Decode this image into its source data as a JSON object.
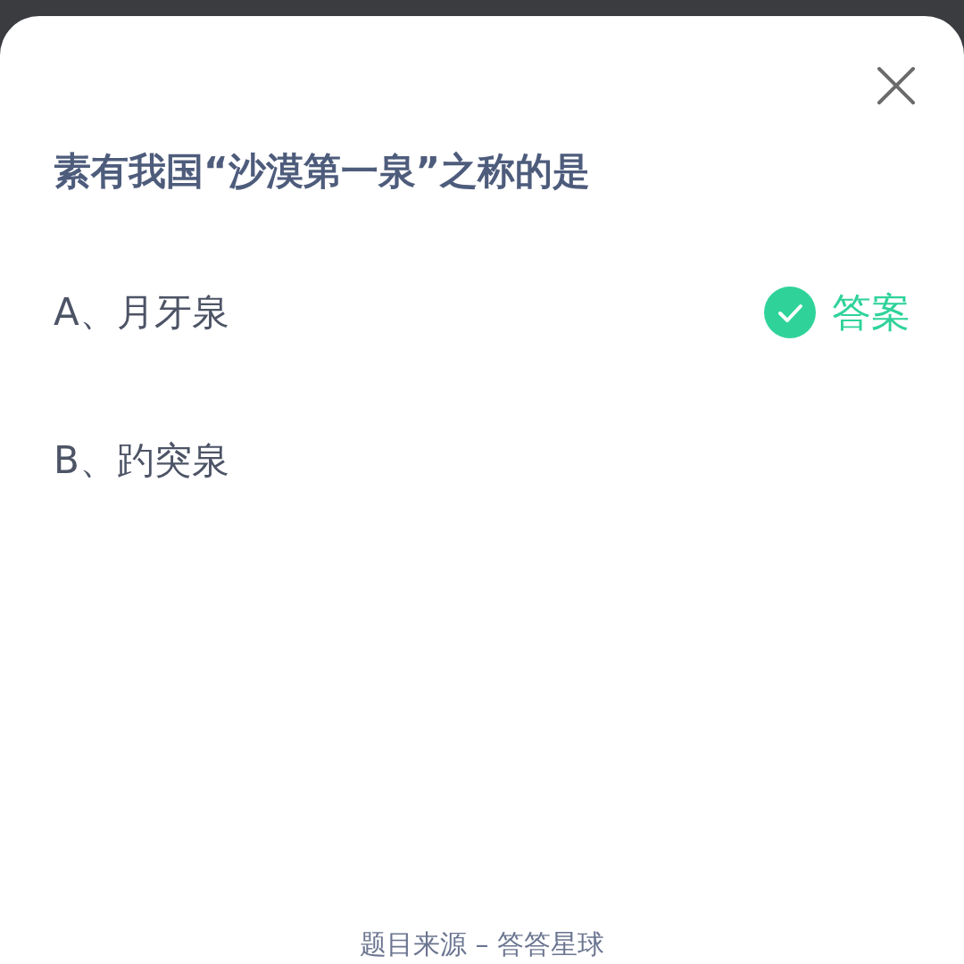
{
  "question": "素有我国“沙漠第一泉”之称的是",
  "options": [
    {
      "label": "A、月牙泉",
      "correct": true
    },
    {
      "label": "B、趵突泉",
      "correct": false
    }
  ],
  "answer_badge": "答案",
  "footer": "题目来源 – 答答星球"
}
